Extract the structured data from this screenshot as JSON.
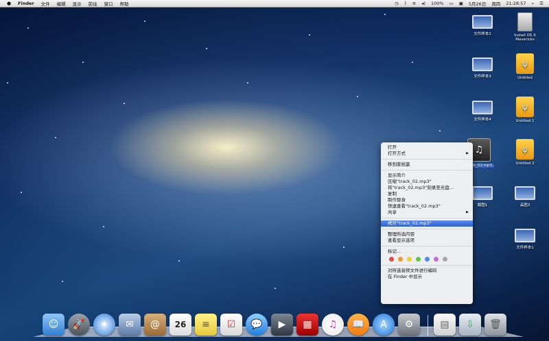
{
  "menubar": {
    "apple": "",
    "app": "Finder",
    "items": [
      "文件",
      "编辑",
      "显示",
      "前往",
      "窗口",
      "帮助"
    ],
    "battery": "100%",
    "date": "5月26日",
    "weekday": "周四",
    "time": "21:28:57"
  },
  "desktop_icons": {
    "doc2": "文件样本2",
    "installer": "Install OS X Mavericks",
    "doc3": "文件样本3",
    "untitled": "Untitled",
    "doc4": "文件样本4",
    "untitled1": "Untitled 1",
    "track": "track_02.mp3",
    "untitled2": "Untitled 2",
    "img1": "截图1",
    "img3": "品图3",
    "doc1": "文件样本1"
  },
  "context_menu": {
    "open": "打开",
    "open_with": "打开方式",
    "trash": "移到废纸篓",
    "get_info": "显示简介",
    "compress": "压缩\"track_02.mp3\"",
    "burn": "将\"track_02.mp3\"刻录至光盘...",
    "copy_item": "复制",
    "alias": "制作替身",
    "quicklook": "快速查看\"track_02.mp3\"",
    "share": "共享",
    "copy_name": "拷贝\"track_02.mp3\"",
    "clean_up": "整理所选内容",
    "view_options": "查看显示选项",
    "tags": "标记...",
    "tag_colors": [
      "#e04a4a",
      "#f09a2a",
      "#f2d22e",
      "#5cc94a",
      "#4a8ef0",
      "#c46ad6",
      "#a6a6a6"
    ],
    "encode": "对所选音频文件进行编码",
    "show_in_finder": "在 Finder 中显示"
  },
  "dock": {
    "calendar_day": "26"
  }
}
